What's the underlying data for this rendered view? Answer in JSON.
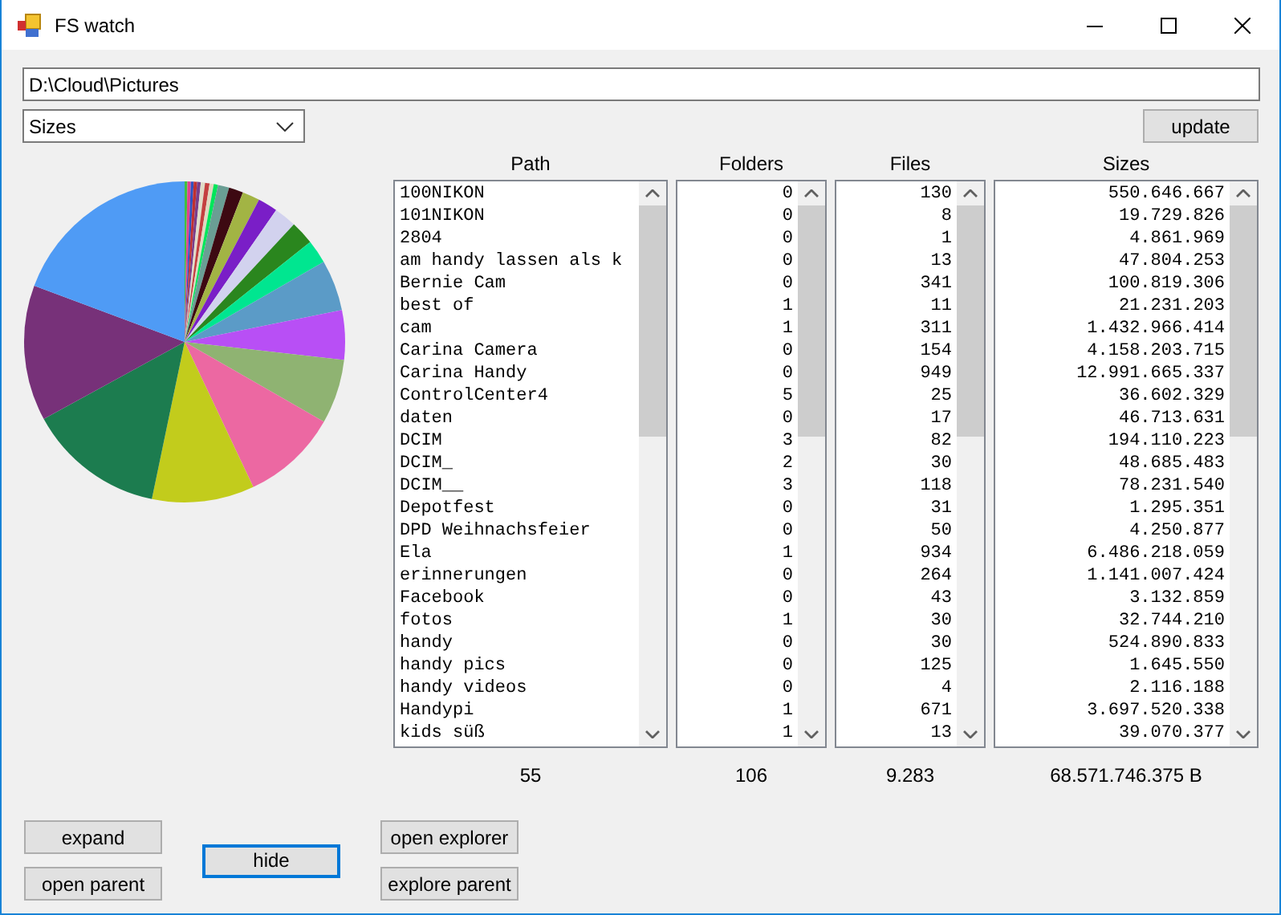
{
  "window": {
    "title": "FS watch"
  },
  "path_field": {
    "value": "D:\\Cloud\\Pictures"
  },
  "view_dropdown": {
    "value": "Sizes"
  },
  "update_button": {
    "label": "update"
  },
  "lists": [
    {
      "header": "Path",
      "total": "55",
      "items": [
        "100NIKON",
        "101NIKON",
        "2804",
        "am handy lassen als k",
        "Bernie Cam",
        "best of",
        "cam",
        "Carina Camera",
        "Carina Handy",
        "ControlCenter4",
        "daten",
        "DCIM",
        "DCIM_",
        "DCIM__",
        "Depotfest",
        "DPD Weihnachsfeier",
        "Ela",
        "erinnerungen",
        "Facebook",
        "fotos",
        "handy",
        "handy pics",
        "handy videos",
        "Handypi",
        "kids süß"
      ]
    },
    {
      "header": "Folders",
      "total": "106",
      "items": [
        "0",
        "0",
        "0",
        "0",
        "0",
        "1",
        "1",
        "0",
        "0",
        "5",
        "0",
        "3",
        "2",
        "3",
        "0",
        "0",
        "1",
        "0",
        "0",
        "1",
        "0",
        "0",
        "0",
        "1",
        "1"
      ]
    },
    {
      "header": "Files",
      "total": "9.283",
      "items": [
        "130",
        "8",
        "1",
        "13",
        "341",
        "11",
        "311",
        "154",
        "949",
        "25",
        "17",
        "82",
        "30",
        "118",
        "31",
        "50",
        "934",
        "264",
        "43",
        "30",
        "30",
        "125",
        "4",
        "671",
        "13"
      ]
    },
    {
      "header": "Sizes",
      "total": "68.571.746.375 B",
      "items": [
        "550.646.667",
        "19.729.826",
        "4.861.969",
        "47.804.253",
        "100.819.306",
        "21.231.203",
        "1.432.966.414",
        "4.158.203.715",
        "12.991.665.337",
        "36.602.329",
        "46.713.631",
        "194.110.223",
        "48.685.483",
        "78.231.540",
        "1.295.351",
        "4.250.877",
        "6.486.218.059",
        "1.141.007.424",
        "3.132.859",
        "32.744.210",
        "524.890.833",
        "1.645.550",
        "2.116.188",
        "3.697.520.338",
        "39.070.377"
      ]
    }
  ],
  "buttons": [
    {
      "label": "expand",
      "focused": false
    },
    {
      "label": "open parent",
      "focused": false
    },
    {
      "label": "hide",
      "focused": true
    },
    {
      "label": "open explorer",
      "focused": false
    },
    {
      "label": "explore parent",
      "focused": false
    }
  ]
}
